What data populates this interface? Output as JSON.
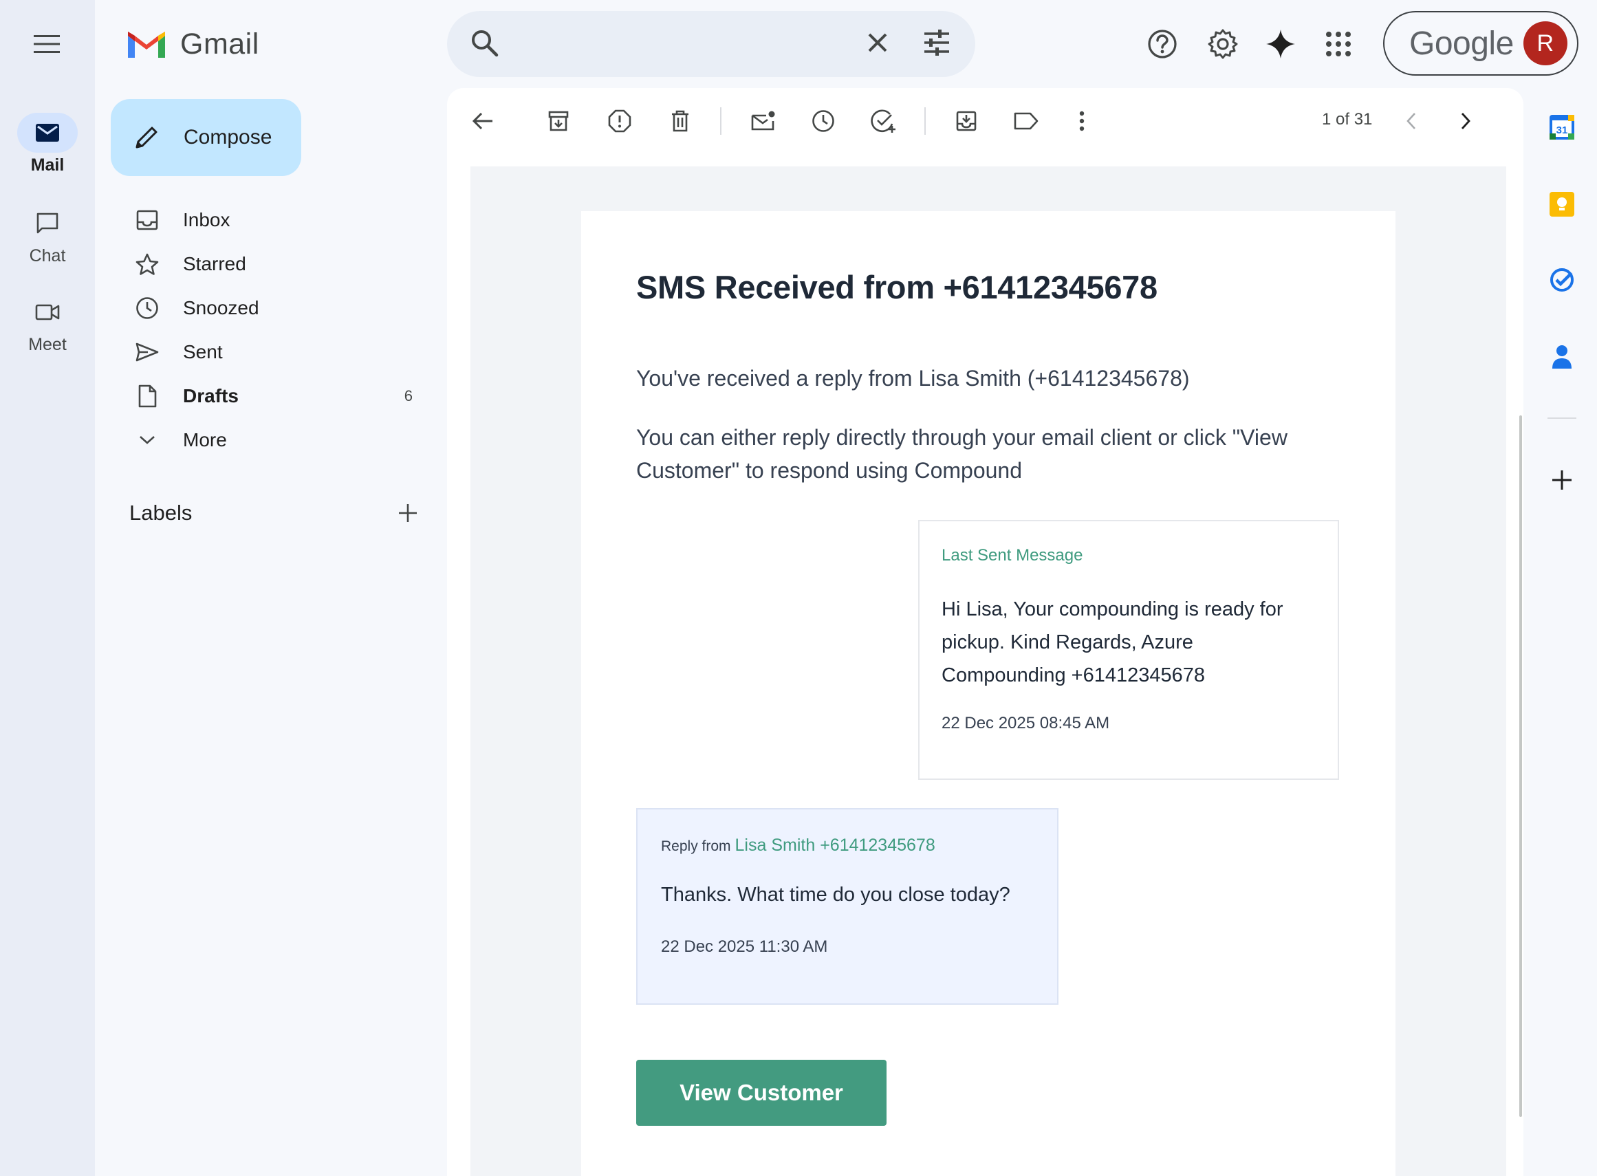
{
  "rail": {
    "items": [
      {
        "label": "Mail"
      },
      {
        "label": "Chat"
      },
      {
        "label": "Meet"
      }
    ]
  },
  "brand": {
    "name": "Gmail"
  },
  "compose": {
    "label": "Compose"
  },
  "nav": {
    "items": [
      {
        "label": "Inbox",
        "icon": "inbox-icon"
      },
      {
        "label": "Starred",
        "icon": "star-icon"
      },
      {
        "label": "Snoozed",
        "icon": "clock-icon"
      },
      {
        "label": "Sent",
        "icon": "send-icon"
      },
      {
        "label": "Drafts",
        "icon": "draft-icon",
        "count": "6"
      },
      {
        "label": "More",
        "icon": "chevron-down-icon"
      }
    ]
  },
  "labels": {
    "title": "Labels"
  },
  "search": {
    "placeholder": ""
  },
  "account": {
    "brand": "Google",
    "initial": "R"
  },
  "pager": {
    "text": "1 of 31"
  },
  "email": {
    "title": "SMS Received from +61412345678",
    "intro": "You've received a reply from Lisa Smith (+61412345678)",
    "instructions": "You can either reply directly through your email client or click \"View Customer\" to respond using Compound",
    "last_sent": {
      "heading": "Last Sent Message",
      "body": "Hi Lisa, Your compounding is ready for pickup. Kind Regards, Azure Compounding +61412345678",
      "date": "22 Dec 2025 08:45 AM"
    },
    "reply": {
      "prefix": "Reply from",
      "name": "Lisa Smith +61412345678",
      "body": "Thanks. What time do you close today?",
      "date": "22 Dec 2025 11:30 AM"
    },
    "button": "View Customer"
  },
  "side_panel": {
    "calendar_day": "31"
  },
  "colors": {
    "accent_green": "#439b80",
    "label_green": "#3f9b7f",
    "compose_bg": "#c2e7ff",
    "avatar": "#b3261e"
  }
}
